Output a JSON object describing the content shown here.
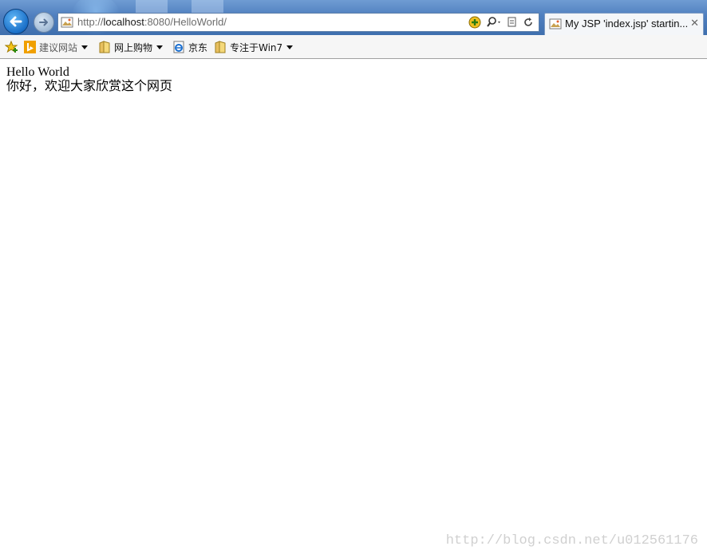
{
  "browser": {
    "address": {
      "scheme": "http://",
      "host": "localhost",
      "rest": ":8080/HelloWorld/"
    },
    "tab": {
      "title": "My JSP 'index.jsp' startin...",
      "close_glyph": "✕"
    },
    "favorites": [
      {
        "label": "建议网站",
        "icon": "bing-icon",
        "dropdown": true
      },
      {
        "label": "网上购物",
        "icon": "folder-icon",
        "dropdown": true
      },
      {
        "label": "京东",
        "icon": "ie-page-icon",
        "dropdown": false
      },
      {
        "label": "专注于Win7",
        "icon": "folder-icon",
        "dropdown": true
      }
    ]
  },
  "page": {
    "line1": "Hello World",
    "line2": "你好，欢迎大家欣赏这个网页"
  },
  "watermark": "http://blog.csdn.net/u012561176",
  "colors": {
    "frame_blue": "#4f7fbf",
    "back_button": "#1a6fc8",
    "favorites_bg": "#f6f6f6"
  }
}
